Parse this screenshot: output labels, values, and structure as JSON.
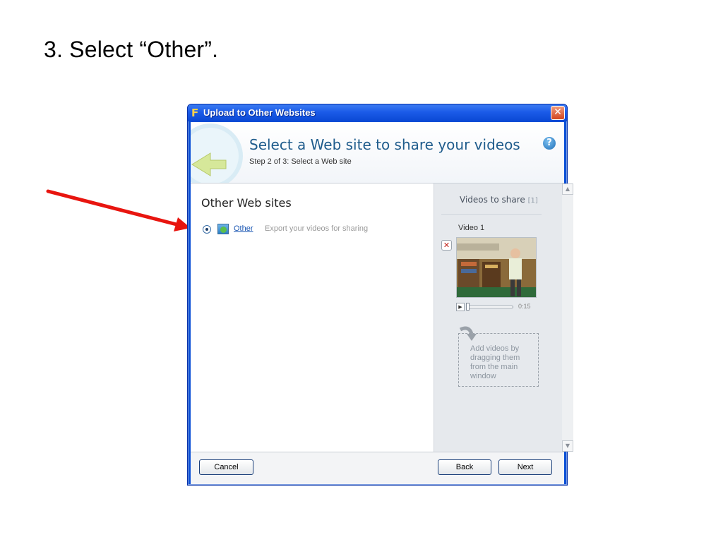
{
  "instruction": "3.  Select “Other”.",
  "dialog": {
    "title": "Upload to Other Websites",
    "app_icon": "F",
    "close_glyph": "✕",
    "header": {
      "title": "Select a Web site to share your videos",
      "step": "Step 2 of 3: Select a Web site",
      "help_glyph": "?"
    },
    "left": {
      "heading": "Other Web sites",
      "option": {
        "label": "Other",
        "description": "Export your videos for sharing",
        "selected": true
      }
    },
    "right": {
      "title": "Videos to share",
      "count": "[1]",
      "video_label": "Video 1",
      "duration": "0:15",
      "remove_glyph": "✕",
      "play_glyph": "▶",
      "drop_hint": "Add videos by dragging them from the main window"
    },
    "scroll": {
      "up_glyph": "▲",
      "down_glyph": "▼"
    },
    "footer": {
      "cancel": "Cancel",
      "back": "Back",
      "next": "Next"
    }
  },
  "colors": {
    "titlebar": "#1b5be8",
    "header_title": "#1f5c8c",
    "link": "#1a56b3",
    "arrow": "#e8150f"
  },
  "icons": [
    "app-icon",
    "close-icon",
    "help-icon",
    "globe-icon",
    "remove-icon",
    "play-icon",
    "curved-arrow-icon"
  ]
}
